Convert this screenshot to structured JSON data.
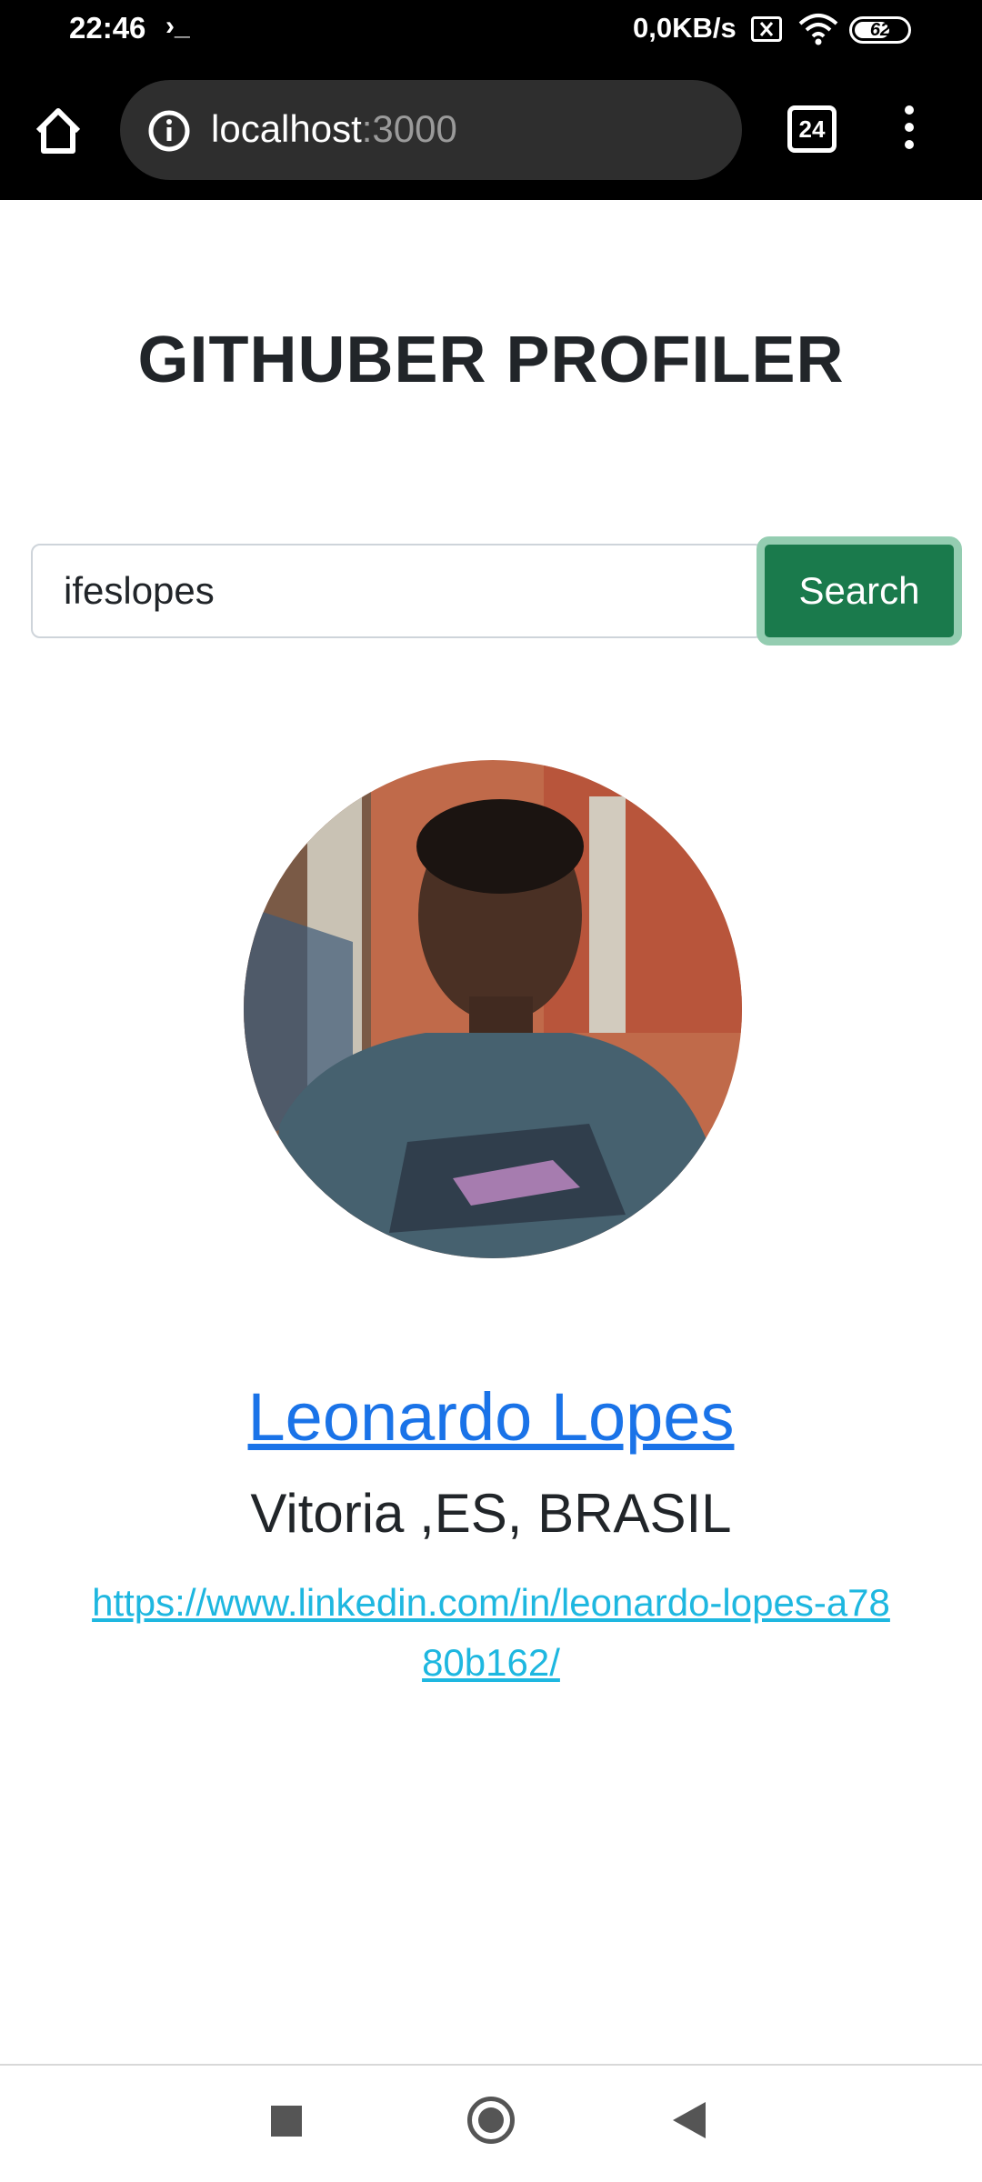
{
  "status_bar": {
    "time": "22:46",
    "prompt": "›_",
    "net_speed": "0,0KB/s",
    "battery_level": "62",
    "icons": [
      "terminal-icon",
      "sim-off-icon",
      "wifi-icon",
      "battery-icon"
    ]
  },
  "browser": {
    "url_host": "localhost",
    "url_port": ":3000",
    "tab_count": "24",
    "icons": [
      "home-icon",
      "info-icon",
      "tabs-icon",
      "more-vert-icon"
    ]
  },
  "page": {
    "title": "GITHUBER PROFILER",
    "search": {
      "value": "ifeslopes",
      "button_label": "Search"
    },
    "profile": {
      "name": "Leonardo Lopes",
      "location": "Vitoria ,ES, BRASIL",
      "linkedin": "https://www.linkedin.com/in/leonardo-lopes-a7880b162/"
    }
  },
  "nav_bar": {
    "icons": [
      "recents-icon",
      "home-circle-icon",
      "back-icon"
    ]
  },
  "colors": {
    "button_bg": "#1a7a4c",
    "button_focus_ring": "#94cdb1",
    "name_link": "#1a73e8",
    "linkedin_link": "#1eb7e0"
  }
}
